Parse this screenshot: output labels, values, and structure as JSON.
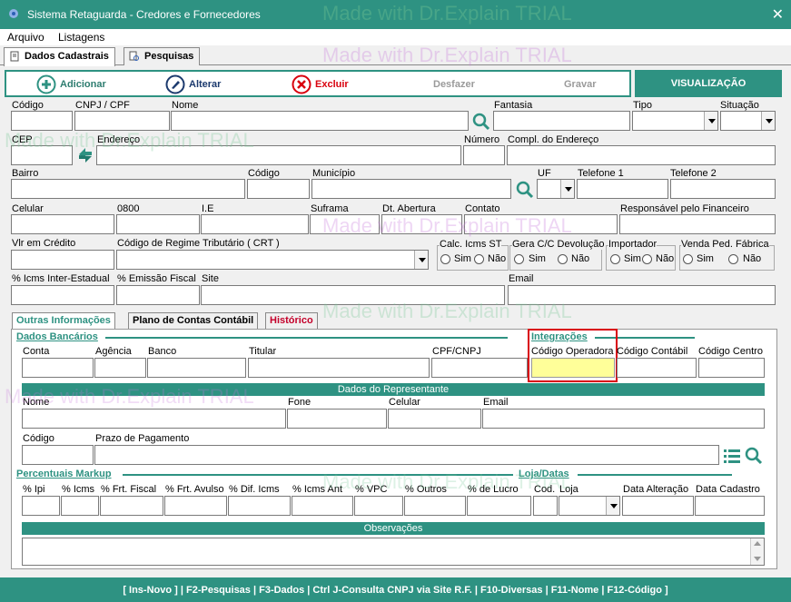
{
  "window": {
    "title": "Sistema Retaguarda -  Credores e Fornecedores",
    "close": "✕"
  },
  "menu": [
    "Arquivo",
    "Listagens"
  ],
  "tabs": [
    "Dados Cadastrais",
    "Pesquisas"
  ],
  "toolbar": {
    "add": "Adicionar",
    "edit": "Alterar",
    "del": "Excluir",
    "undo": "Desfazer",
    "save": "Gravar",
    "view": "VISUALIZAÇÃO"
  },
  "fields": {
    "codigo": "Código",
    "cnpj": "CNPJ / CPF",
    "nome": "Nome",
    "fantasia": "Fantasia",
    "tipo": "Tipo",
    "situacao": "Situação",
    "cep": "CEP",
    "endereco": "Endereço",
    "numero": "Número",
    "compl": "Compl. do Endereço",
    "bairro": "Bairro",
    "codigo2": "Código",
    "municipio": "Município",
    "uf": "UF",
    "tel1": "Telefone 1",
    "tel2": "Telefone 2",
    "celular": "Celular",
    "f0800": "0800",
    "ie": "I.E",
    "suframa": "Suframa",
    "dtabertura": "Dt. Abertura",
    "contato": "Contato",
    "respfin": "Responsável pelo Financeiro",
    "vlcredito": "Vlr em Crédito",
    "crt": "Código de Regime Tributário ( CRT )",
    "calcicms": "Calc. Icms ST",
    "geracc": "Gera C/C Devolução",
    "importador": "Importador",
    "vendaped": "Venda Ped. Fábrica",
    "sim": "Sim",
    "nao": "Não",
    "icmsinter": "% Icms Inter-Estadual",
    "emissao": "% Emissão Fiscal",
    "site": "Site",
    "email": "Email"
  },
  "subtabs": [
    "Outras Informações",
    "Plano de Contas Contábil",
    "Histórico"
  ],
  "bank": {
    "title": "Dados Bancários",
    "conta": "Conta",
    "agencia": "Agência",
    "banco": "Banco",
    "titular": "Titular",
    "cpfcnpj": "CPF/CNPJ"
  },
  "integ": {
    "title": "Integrações",
    "codop": "Código Operadora",
    "codcont": "Código Contábil",
    "codcentro": "Código Centro"
  },
  "rep": {
    "title": "Dados do Representante",
    "nome": "Nome",
    "fone": "Fone",
    "celular": "Celular",
    "email": "Email",
    "codigo": "Código",
    "prazo": "Prazo de Pagamento"
  },
  "markup": {
    "title": "Percentuais Markup",
    "cols": [
      "% Ipi",
      "% Icms",
      "% Frt. Fiscal",
      "% Frt. Avulso",
      "% Dif. Icms",
      "% Icms Ant",
      "% VPC",
      "% Outros",
      "% de Lucro"
    ]
  },
  "loja": {
    "title": "Loja/Datas",
    "cod": "Cod.",
    "loja": "Loja",
    "dtalt": "Data Alteração",
    "dtcad": "Data Cadastro"
  },
  "obs": "Observações",
  "watermark": "Made with Dr.Explain TRIAL",
  "footer": "[ Ins-Novo ] | F2-Pesquisas | F3-Dados | Ctrl J-Consulta CNPJ via Site R.F. |  F10-Diversas | F11-Nome  | F12-Código ]",
  "colors": {
    "accent": "#2e9282",
    "highlight": "#d9000d",
    "activeField": "#ffff99"
  }
}
